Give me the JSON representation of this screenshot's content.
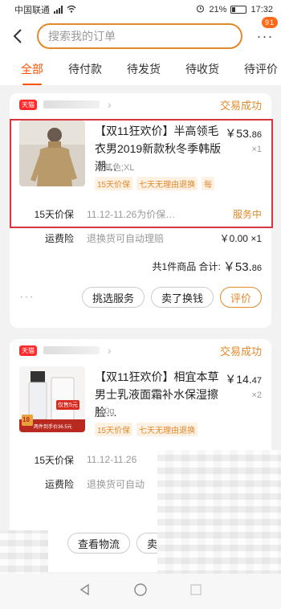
{
  "statusbar": {
    "carrier": "中国联通",
    "battery": "21%",
    "time": "17:32"
  },
  "header": {
    "search_placeholder": "搜索我的订单",
    "more_badge": "91"
  },
  "tabs": [
    {
      "label": "全部",
      "active": true
    },
    {
      "label": "待付款"
    },
    {
      "label": "待发货"
    },
    {
      "label": "待收货"
    },
    {
      "label": "待评价"
    }
  ],
  "orders": [
    {
      "shop_tag": "天猫",
      "status": "交易成功",
      "item": {
        "title": "【双11狂欢价】半高领毛衣男2019新款秋冬季韩版潮…",
        "sku": "卡其色;XL",
        "tags": [
          "15天价保",
          "七天无理由退换",
          "每"
        ],
        "price_main": "￥53.",
        "price_dec": "86",
        "qty": "×1"
      },
      "service": {
        "name": "15天价保",
        "desc": "11.12-11.26为价保…",
        "status": "服务中"
      },
      "fee": {
        "name": "运费险",
        "desc": "退换货可自动理赔",
        "value": "￥0.00 ×1"
      },
      "total": {
        "label": "共1件商品 合计:",
        "amount_main": "￥53.",
        "amount_dec": "86"
      },
      "actions": [
        "挑选服务",
        "卖了换钱",
        "评价"
      ]
    },
    {
      "shop_tag": "天猫",
      "status": "交易成功",
      "item": {
        "title": "【双11狂欢价】相宜本草男士乳液面霜补水保湿擦脸…",
        "sku": "120g",
        "tags": [
          "15天价保",
          "七天无理由退换"
        ],
        "price_main": "￥14.",
        "price_dec": "47",
        "qty": "×2",
        "thumb_text": "仅售5元",
        "thumb_price": "18",
        "thumb_caption": "两件到手价36.5元"
      },
      "service": {
        "name": "15天价保",
        "desc": "11.12-11.26"
      },
      "fee": {
        "name": "运费险",
        "desc": "退换货可自动"
      },
      "actions": [
        "查看物流",
        "卖"
      ]
    }
  ],
  "colors": {
    "accent": "#ff5000",
    "status": "#e08a2b",
    "highlight": "#d9363e"
  }
}
